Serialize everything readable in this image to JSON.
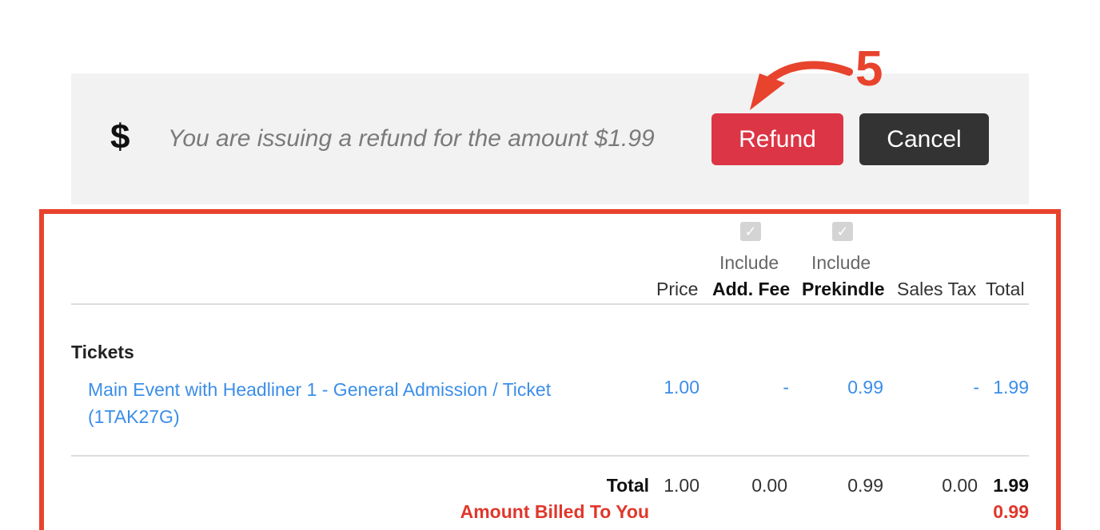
{
  "refund_bar": {
    "icon": "dollar-sign-icon",
    "message": "You are issuing a refund for the amount $1.99",
    "refund_label": "Refund",
    "cancel_label": "Cancel",
    "annotation_number": "5"
  },
  "table": {
    "headers": {
      "price": "Price",
      "include1": "Include",
      "add_fee": "Add. Fee",
      "include2": "Include",
      "prekindle": "Prekindle",
      "sales_tax": "Sales Tax",
      "total": "Total"
    },
    "include_add_fee_checked": true,
    "include_prekindle_checked": true,
    "section_title": "Tickets",
    "rows": [
      {
        "name": "Main Event with Headliner 1 - General Admission / Ticket (1TAK27G)",
        "price": "1.00",
        "add_fee": "-",
        "prekindle": "0.99",
        "sales_tax": "-",
        "total": "1.99"
      }
    ],
    "totals": {
      "label": "Total",
      "price": "1.00",
      "add_fee": "0.00",
      "prekindle": "0.99",
      "sales_tax": "0.00",
      "total": "1.99"
    },
    "billed": {
      "label": "Amount Billed To You",
      "value": "0.99"
    }
  },
  "colors": {
    "refund_button": "#dc3545",
    "cancel_button": "#333333",
    "link": "#3b8ee8",
    "annotation": "#e8432d"
  }
}
